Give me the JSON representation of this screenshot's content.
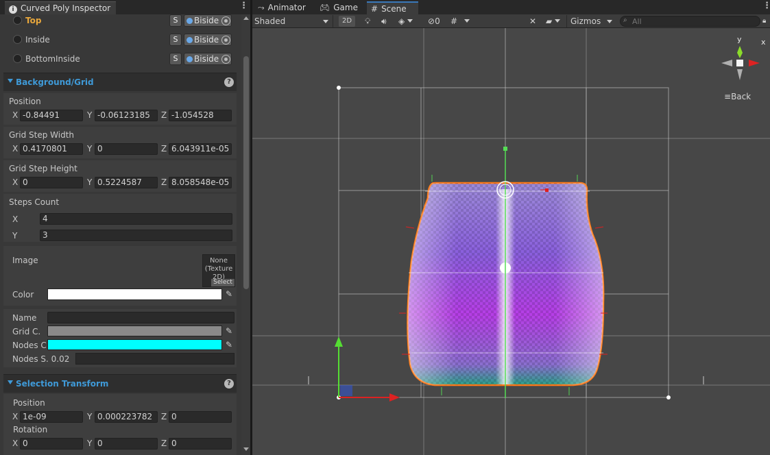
{
  "inspector": {
    "tab_title": "Curved Poly Inspector",
    "layers": [
      {
        "name": "Top",
        "s": "S",
        "side": "Biside"
      },
      {
        "name": "Inside",
        "s": "S",
        "side": "Biside"
      },
      {
        "name": "BottomInside",
        "s": "S",
        "side": "Biside"
      }
    ],
    "background_grid": {
      "title": "Background/Grid",
      "position": {
        "label": "Position",
        "x": "-0.84491",
        "y": "-0.06123185",
        "z": "-1.054528"
      },
      "grid_step_width": {
        "label": "Grid Step Width",
        "x": "0.4170801",
        "y": "0",
        "z": "6.043911e-05"
      },
      "grid_step_height": {
        "label": "Grid Step Height",
        "x": "0",
        "y": "0.5224587",
        "z": "8.058548e-05"
      },
      "steps_count": {
        "label": "Steps Count",
        "x": "4",
        "y": "3"
      },
      "image": {
        "label": "Image",
        "value_line1": "None",
        "value_line2": "(Texture",
        "value_line3": "2D)",
        "select": "Select"
      },
      "color": {
        "label": "Color",
        "value": "#ffffff"
      }
    },
    "name_block": {
      "name_label": "Name",
      "name_value": "",
      "grid_color_label": "Grid C.",
      "grid_color": "#8a8a8a",
      "nodes_color_label": "Nodes C",
      "nodes_color": "#00ffff",
      "nodes_size_label": "Nodes S.",
      "nodes_size": "0.02"
    },
    "selection_transform": {
      "title": "Selection Transform",
      "position": {
        "label": "Position",
        "x": "1e-09",
        "y": "0.000223782",
        "z": "0"
      },
      "rotation": {
        "label": "Rotation",
        "x": "0",
        "y": "0",
        "z": "0"
      }
    },
    "axis": {
      "x": "X",
      "y": "Y",
      "z": "Z"
    }
  },
  "scene": {
    "tabs": [
      {
        "label": "Animator",
        "icon": "animator-icon"
      },
      {
        "label": "Game",
        "icon": "gamepad-icon"
      },
      {
        "label": "Scene",
        "icon": "grid-icon",
        "active": true
      }
    ],
    "toolbar": {
      "shading": "Shaded",
      "mode_2d": "2D",
      "hidden_count": "0",
      "gizmos": "Gizmos",
      "search_placeholder": "All"
    },
    "gizmo_label": "Back"
  }
}
